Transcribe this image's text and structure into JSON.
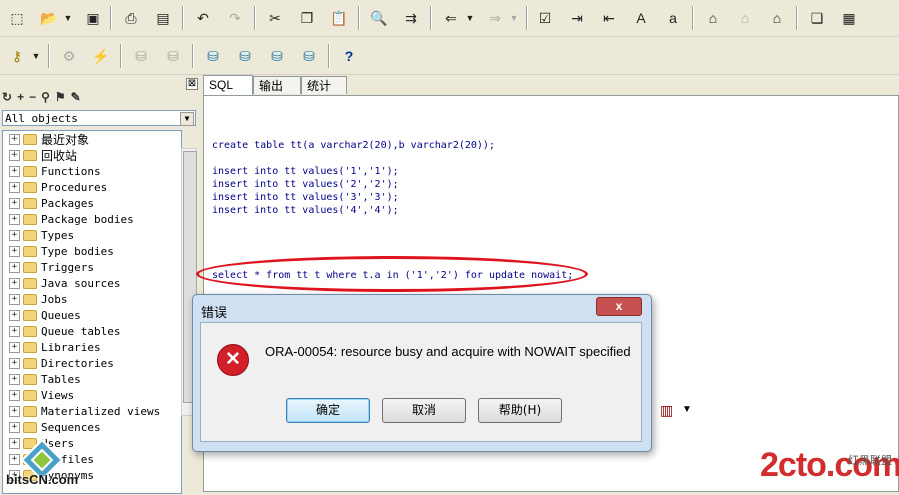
{
  "toolbar": {
    "row1_icons": [
      "new-icon",
      "open-icon",
      "save-icon",
      "print-icon",
      "print-preview-icon",
      "undo-icon",
      "redo-icon",
      "cut-icon",
      "copy-icon",
      "paste-icon",
      "find-icon",
      "find-next-icon",
      "import-icon",
      "export-icon",
      "compile-icon",
      "indent-icon",
      "unindent-icon",
      "uppercase-icon",
      "lowercase-icon",
      "connect-icon",
      "disconnect-icon",
      "commit-window-icon",
      "window-list-icon",
      "tile-icon"
    ],
    "row2_icons": [
      "key-icon",
      "gear-icon",
      "lightning-icon",
      "commit-icon",
      "rollback-icon",
      "sql-icon",
      "sql-explain-icon",
      "db-icon",
      "db-export-icon",
      "help-icon"
    ]
  },
  "left_panel": {
    "close": "⊠",
    "dropdown_value": "All objects",
    "tree_items": [
      {
        "label": "最近对象"
      },
      {
        "label": "回收站"
      },
      {
        "label": "Functions"
      },
      {
        "label": "Procedures"
      },
      {
        "label": "Packages"
      },
      {
        "label": "Package bodies"
      },
      {
        "label": "Types"
      },
      {
        "label": "Type bodies"
      },
      {
        "label": "Triggers"
      },
      {
        "label": "Java sources"
      },
      {
        "label": "Jobs"
      },
      {
        "label": "Queues"
      },
      {
        "label": "Queue tables"
      },
      {
        "label": "Libraries"
      },
      {
        "label": "Directories"
      },
      {
        "label": "Tables"
      },
      {
        "label": "Views"
      },
      {
        "label": "Materialized views"
      },
      {
        "label": "Sequences"
      },
      {
        "label": "Users"
      },
      {
        "label": "Profiles"
      },
      {
        "label": "Synonyms"
      }
    ]
  },
  "tabs": [
    "SQL",
    "输出",
    "统计表"
  ],
  "editor": {
    "lines": [
      "create table tt(a varchar2(20),b varchar2(20));",
      "insert into tt values('1','1');",
      "insert into tt values('2','2');",
      "insert into tt values('3','3');",
      "insert into tt values('4','4');",
      "select * from tt t where t.a in ('1','2') for update nowait;"
    ]
  },
  "dialog": {
    "title": "错误",
    "close": "x",
    "message": "ORA-00054: resource busy and acquire with NOWAIT specified",
    "buttons": [
      "确定",
      "取消",
      "帮助(H)"
    ]
  },
  "watermarks": {
    "left_text": "bitsCN.com",
    "right_text": "2cto.com",
    "right_small": "红黑联盟"
  },
  "colors": {
    "highlight": "#e0141e",
    "error": "#d21f28",
    "code": "#00008b"
  }
}
